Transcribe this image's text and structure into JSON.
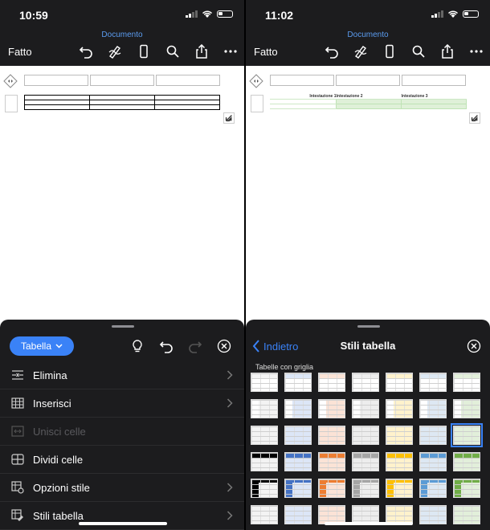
{
  "screens": [
    {
      "status": {
        "time": "10:59"
      },
      "nav": {
        "title": "Documento",
        "done": "Fatto"
      },
      "panel": {
        "tab_label": "Tabella",
        "menu": [
          {
            "label": "Elimina",
            "icon": "delete-rows-icon",
            "enabled": true,
            "chevron": true
          },
          {
            "label": "Inserisci",
            "icon": "insert-table-icon",
            "enabled": true,
            "chevron": true
          },
          {
            "label": "Unisci celle",
            "icon": "merge-cells-icon",
            "enabled": false,
            "chevron": false
          },
          {
            "label": "Dividi celle",
            "icon": "split-cells-icon",
            "enabled": true,
            "chevron": false
          },
          {
            "label": "Opzioni stile",
            "icon": "style-options-icon",
            "enabled": true,
            "chevron": true
          },
          {
            "label": "Stili tabella",
            "icon": "table-styles-icon",
            "enabled": true,
            "chevron": true
          }
        ]
      }
    },
    {
      "status": {
        "time": "11:02"
      },
      "nav": {
        "title": "Documento",
        "done": "Fatto"
      },
      "table_headers": [
        "Intestazione 1",
        "Intestazione 2",
        "Intestazione 3"
      ],
      "panel": {
        "back_label": "Indietro",
        "title": "Stili tabella",
        "section_label": "Tabelle con griglia",
        "style_columns": [
          "#f3f3f3",
          "#dce6f7",
          "#fbe3d6",
          "#ededed",
          "#fff2cc",
          "#dde8f3",
          "#e2efda"
        ],
        "style_accent": [
          "#000000",
          "#4472c4",
          "#ed7d31",
          "#a5a5a5",
          "#ffc000",
          "#5b9bd5",
          "#70ad47"
        ],
        "selected_style": {
          "row": 2,
          "col": 6
        }
      }
    }
  ],
  "accent_color": "#3a82f7"
}
